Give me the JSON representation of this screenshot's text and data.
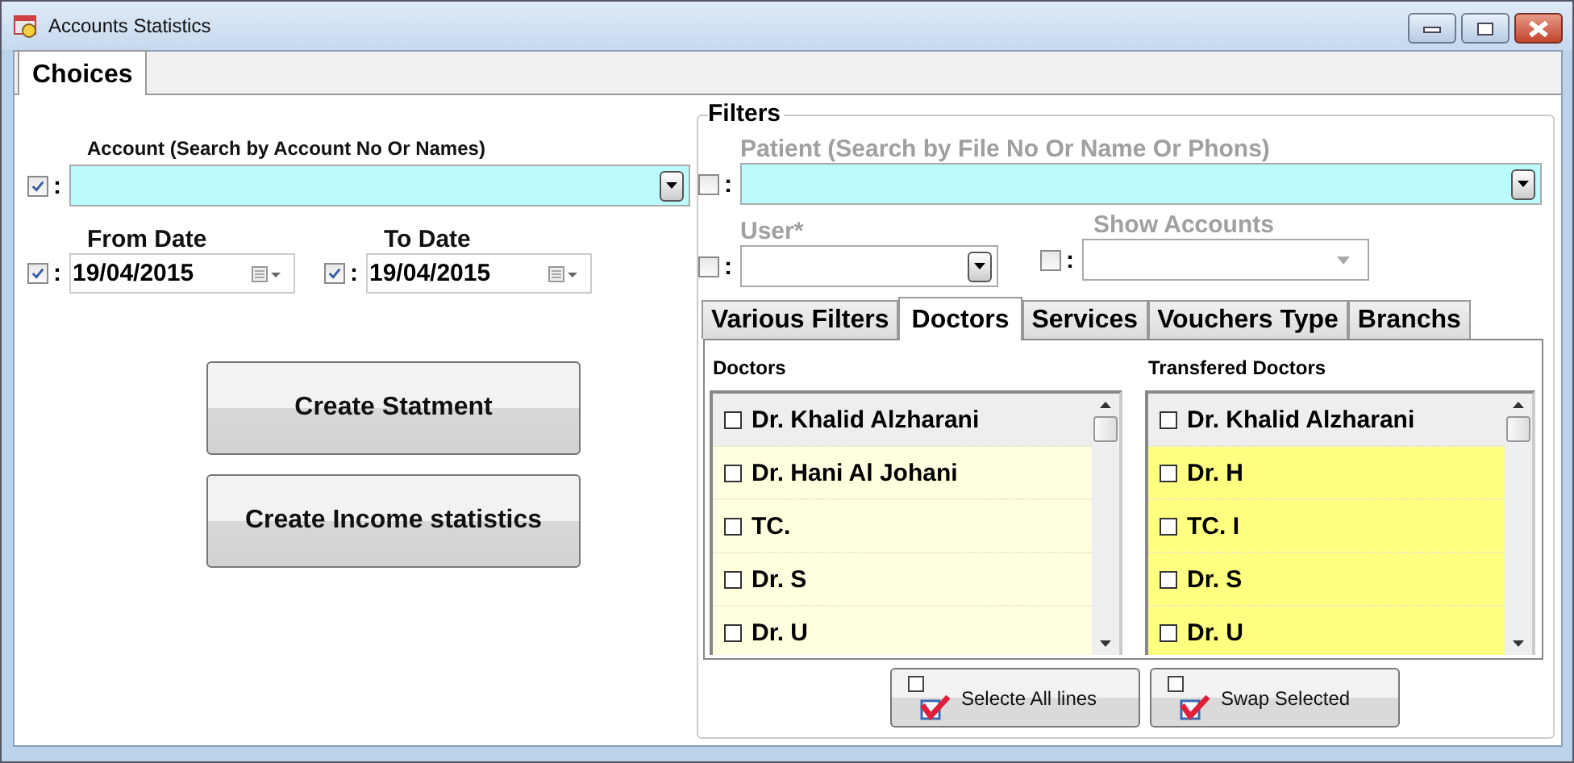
{
  "window": {
    "title": "Accounts Statistics"
  },
  "tabs": [
    {
      "label": "Choices",
      "selected": true
    }
  ],
  "account": {
    "label": "Account (Search by Account No Or Names)",
    "checked": true,
    "separator": ":"
  },
  "from_date": {
    "label": "From Date",
    "value": "19/04/2015",
    "checked": true,
    "separator": ":"
  },
  "to_date": {
    "label": "To Date",
    "value": "19/04/2015",
    "checked": true,
    "separator": ":"
  },
  "buttons": [
    "Create Statment",
    "Create Income statistics"
  ],
  "filters": {
    "title": "Filters",
    "patient": {
      "label": "Patient (Search by File No Or Name Or Phons)",
      "checked": false,
      "separator": ":"
    },
    "user": {
      "label": "User*",
      "checked": false,
      "separator": ":"
    },
    "show_accounts": {
      "label": "Show Accounts",
      "checked": false,
      "disabled": true,
      "separator": ":"
    },
    "tabs": [
      {
        "label": "Various Filters",
        "selected": false
      },
      {
        "label": "Doctors",
        "selected": true
      },
      {
        "label": "Services",
        "selected": false
      },
      {
        "label": "Vouchers Type",
        "selected": false
      },
      {
        "label": "Branchs",
        "selected": false
      }
    ],
    "lists": [
      {
        "label": "Doctors",
        "color": "#ffffe0",
        "rows": [
          {
            "name": "Dr. Khalid Alzharani",
            "checked": false,
            "selected": true
          },
          {
            "name": "Dr. Hani Al Johani",
            "checked": false,
            "selected": false
          },
          {
            "name": "TC.",
            "checked": false,
            "selected": false
          },
          {
            "name": "Dr. S",
            "checked": false,
            "selected": false
          },
          {
            "name": "Dr. U",
            "checked": false,
            "selected": false
          }
        ]
      },
      {
        "label": "Transfered Doctors",
        "color": "#ffff80",
        "rows": [
          {
            "name": "Dr. Khalid Alzharani",
            "checked": false,
            "selected": true
          },
          {
            "name": "Dr. H",
            "checked": false,
            "selected": false
          },
          {
            "name": "TC. I",
            "checked": false,
            "selected": false
          },
          {
            "name": "Dr. S",
            "checked": false,
            "selected": false
          },
          {
            "name": "Dr. U",
            "checked": false,
            "selected": false
          }
        ]
      }
    ],
    "buttons": [
      "Selecte All lines",
      "Swap Selected"
    ]
  }
}
